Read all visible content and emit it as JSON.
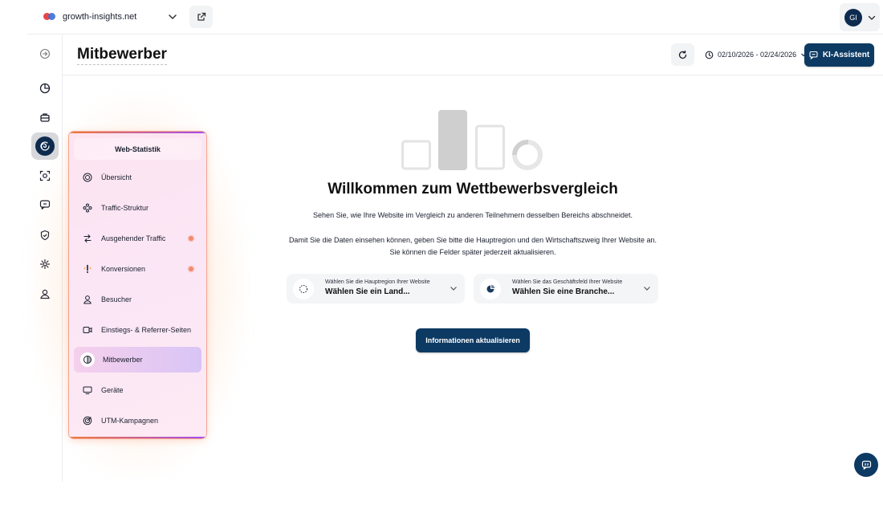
{
  "topbar": {
    "site": "growth-insights.net",
    "user_initials": "GI"
  },
  "header": {
    "title": "Mitbewerber",
    "date_range": "02/10/2026 - 02/24/2026",
    "ai_button": "KI-Assistent"
  },
  "submenu": {
    "heading": "Web-Statistik",
    "items": [
      {
        "label": "Übersicht",
        "icon": "target-icon"
      },
      {
        "label": "Traffic-Struktur",
        "icon": "network-icon"
      },
      {
        "label": "Ausgehender Traffic",
        "icon": "outgoing-icon",
        "badge": true
      },
      {
        "label": "Konversionen",
        "icon": "conversion-icon",
        "badge": true
      },
      {
        "label": "Besucher",
        "icon": "user-icon"
      },
      {
        "label": "Einstiegs- & Referrer-Seiten",
        "icon": "entry-pages-icon"
      },
      {
        "label": "Mitbewerber",
        "icon": "competitor-icon",
        "active": true
      },
      {
        "label": "Geräte",
        "icon": "monitor-icon"
      },
      {
        "label": "UTM-Kampagnen",
        "icon": "campaign-icon"
      }
    ]
  },
  "main": {
    "heading": "Willkommen zum Wettbewerbsvergleich",
    "intro": "Sehen Sie, wie Ihre Website im Vergleich zu anderen Teilnehmern desselben Bereichs abschneidet.",
    "instruction_line1": "Damit Sie die Daten einsehen können, geben Sie bitte die Hauptregion und den Wirtschaftszweig Ihrer Website an.",
    "instruction_line2": "Sie können die Felder später jederzeit aktualisieren.",
    "region_select": {
      "caption": "Wählen Sie die Hauptregion Ihrer Website",
      "value": "Wählen Sie ein Land..."
    },
    "industry_select": {
      "caption": "Wählen Sie das Geschäftsfeld Ihrer Website",
      "value": "Wählen Sie eine Branche..."
    },
    "update_button": "Informationen aktualisieren"
  },
  "colors": {
    "primary": "#0d3a63",
    "badge": "#f28a6a"
  }
}
